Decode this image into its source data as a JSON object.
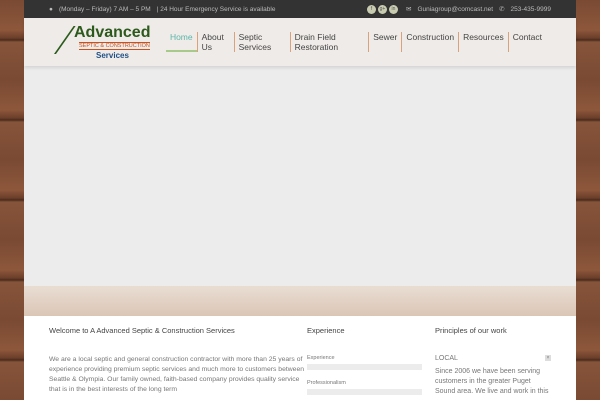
{
  "topbar": {
    "hours": "(Monday – Friday) 7 AM – 5 PM",
    "emergency": "| 24 Hour Emergency Service is available",
    "social": [
      "f",
      "g+",
      "in"
    ],
    "email": "Guniagroup@comcast.net",
    "phone": "253-435-9999"
  },
  "logo": {
    "line1": "Advanced",
    "line2": "SEPTIC & CONSTRUCTION",
    "line3": "Services"
  },
  "nav": [
    "Home",
    "About Us",
    "Septic Services",
    "Drain Field Restoration",
    "Sewer",
    "Construction",
    "Resources",
    "Contact"
  ],
  "welcome": {
    "title": "Welcome to A Advanced Septic & Construction Services",
    "text": "We are a local septic and general construction contractor with more than 25 years of experience providing premium septic services and much more to customers between Seattle & Olympia. Our family owned, faith-based company provides quality service that is in the best interests of the long term"
  },
  "experience": {
    "title": "Experience",
    "bars": [
      "Experience",
      "Professionalism"
    ]
  },
  "principles": {
    "title": "Principles of our work",
    "item": "LOCAL",
    "toggle": "×",
    "text": "Since 2006 we have been serving customers in the greater Puget Sound area. We live and work in this"
  }
}
